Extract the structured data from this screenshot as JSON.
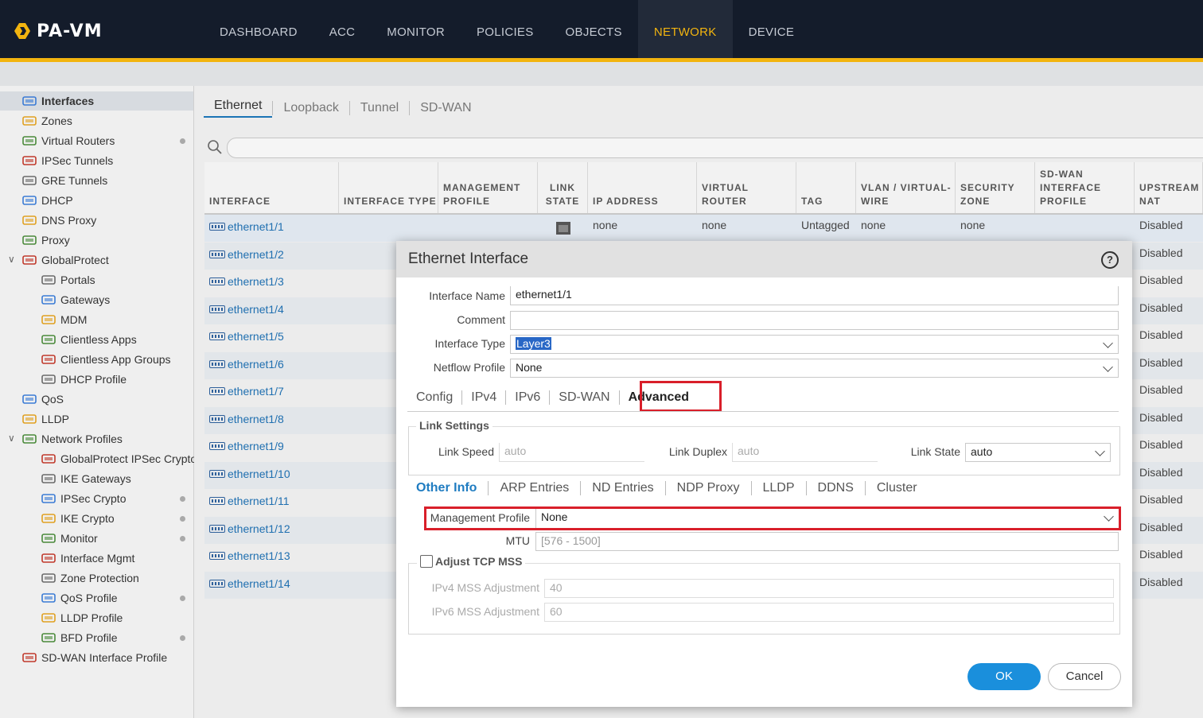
{
  "app": {
    "logo_text": "PA-VM"
  },
  "nav": {
    "items": [
      "DASHBOARD",
      "ACC",
      "MONITOR",
      "POLICIES",
      "OBJECTS",
      "NETWORK",
      "DEVICE"
    ],
    "active": "NETWORK"
  },
  "sidebar": {
    "items": [
      {
        "label": "Interfaces",
        "icon": "interfaces-icon",
        "selected": true
      },
      {
        "label": "Zones",
        "icon": "zones-icon"
      },
      {
        "label": "Virtual Routers",
        "icon": "router-icon",
        "dot": true
      },
      {
        "label": "IPSec Tunnels",
        "icon": "lock-icon"
      },
      {
        "label": "GRE Tunnels",
        "icon": "tunnel-icon"
      },
      {
        "label": "DHCP",
        "icon": "dhcp-icon"
      },
      {
        "label": "DNS Proxy",
        "icon": "dns-icon"
      },
      {
        "label": "Proxy",
        "icon": "proxy-icon"
      },
      {
        "label": "GlobalProtect",
        "icon": "globe-icon",
        "expanded": true
      },
      {
        "label": "Portals",
        "icon": "portal-icon",
        "indent": true
      },
      {
        "label": "Gateways",
        "icon": "gateway-icon",
        "indent": true
      },
      {
        "label": "MDM",
        "icon": "mdm-icon",
        "indent": true
      },
      {
        "label": "Clientless Apps",
        "icon": "apps-icon",
        "indent": true
      },
      {
        "label": "Clientless App Groups",
        "icon": "app-groups-icon",
        "indent": true
      },
      {
        "label": "DHCP Profile",
        "icon": "dhcp-profile-icon",
        "indent": true
      },
      {
        "label": "QoS",
        "icon": "qos-icon"
      },
      {
        "label": "LLDP",
        "icon": "lldp-icon"
      },
      {
        "label": "Network Profiles",
        "icon": "folder-icon",
        "expanded": true
      },
      {
        "label": "GlobalProtect IPSec Crypto",
        "icon": "lock-icon",
        "indent": true
      },
      {
        "label": "IKE Gateways",
        "icon": "ike-icon",
        "indent": true
      },
      {
        "label": "IPSec Crypto",
        "icon": "lock-icon",
        "indent": true,
        "dot": true
      },
      {
        "label": "IKE Crypto",
        "icon": "lock-icon",
        "indent": true,
        "dot": true
      },
      {
        "label": "Monitor",
        "icon": "monitor-icon",
        "indent": true,
        "dot": true
      },
      {
        "label": "Interface Mgmt",
        "icon": "mgmt-icon",
        "indent": true
      },
      {
        "label": "Zone Protection",
        "icon": "shield-icon",
        "indent": true
      },
      {
        "label": "QoS Profile",
        "icon": "qos-icon",
        "indent": true,
        "dot": true
      },
      {
        "label": "LLDP Profile",
        "icon": "lldp-icon",
        "indent": true
      },
      {
        "label": "BFD Profile",
        "icon": "bfd-icon",
        "indent": true,
        "dot": true
      },
      {
        "label": "SD-WAN Interface Profile",
        "icon": "sdwan-icon"
      }
    ]
  },
  "tabs": {
    "items": [
      "Ethernet",
      "Loopback",
      "Tunnel",
      "SD-WAN"
    ],
    "active": "Ethernet"
  },
  "table": {
    "headers": [
      [
        "INTERFACE"
      ],
      [
        "INTERFACE TYPE"
      ],
      [
        "MANAGEMENT",
        "PROFILE"
      ],
      [
        "LINK",
        "STATE"
      ],
      [
        "IP ADDRESS"
      ],
      [
        "VIRTUAL",
        "ROUTER"
      ],
      [
        "TAG"
      ],
      [
        "VLAN / VIRTUAL-",
        "WIRE"
      ],
      [
        "SECURITY",
        "ZONE"
      ],
      [
        "SD-WAN",
        "INTERFACE",
        "PROFILE"
      ],
      [
        "UPSTREAM",
        "NAT"
      ]
    ],
    "first_row": {
      "ip": "none",
      "router": "none",
      "tag": "Untagged",
      "vlan": "none",
      "zone": "none"
    },
    "rows": [
      {
        "name": "ethernet1/1",
        "nat": "Disabled"
      },
      {
        "name": "ethernet1/2",
        "nat": "Disabled"
      },
      {
        "name": "ethernet1/3",
        "nat": "Disabled"
      },
      {
        "name": "ethernet1/4",
        "nat": "Disabled"
      },
      {
        "name": "ethernet1/5",
        "nat": "Disabled"
      },
      {
        "name": "ethernet1/6",
        "nat": "Disabled"
      },
      {
        "name": "ethernet1/7",
        "nat": "Disabled"
      },
      {
        "name": "ethernet1/8",
        "nat": "Disabled"
      },
      {
        "name": "ethernet1/9",
        "nat": "Disabled"
      },
      {
        "name": "ethernet1/10",
        "nat": "Disabled"
      },
      {
        "name": "ethernet1/11",
        "nat": "Disabled"
      },
      {
        "name": "ethernet1/12",
        "nat": "Disabled"
      },
      {
        "name": "ethernet1/13",
        "nat": "Disabled"
      },
      {
        "name": "ethernet1/14",
        "nat": "Disabled"
      }
    ]
  },
  "modal": {
    "title": "Ethernet Interface",
    "help_label": "?",
    "fields": {
      "interface_name": {
        "label": "Interface Name",
        "value": "ethernet1/1"
      },
      "comment": {
        "label": "Comment",
        "value": ""
      },
      "interface_type": {
        "label": "Interface Type",
        "value": "Layer3"
      },
      "netflow_profile": {
        "label": "Netflow Profile",
        "value": "None"
      }
    },
    "tabs": [
      "Config",
      "IPv4",
      "IPv6",
      "SD-WAN",
      "Advanced"
    ],
    "active_tab": "Advanced",
    "link_settings": {
      "legend": "Link Settings",
      "speed_label": "Link Speed",
      "speed_value": "auto",
      "duplex_label": "Link Duplex",
      "duplex_value": "auto",
      "state_label": "Link State",
      "state_value": "auto"
    },
    "subtabs": [
      "Other Info",
      "ARP Entries",
      "ND Entries",
      "NDP Proxy",
      "LLDP",
      "DDNS",
      "Cluster"
    ],
    "active_subtab": "Other Info",
    "mgmt_profile": {
      "label": "Management Profile",
      "value": "None"
    },
    "mtu": {
      "label": "MTU",
      "placeholder": "[576 - 1500]"
    },
    "tcp_mss": {
      "legend": "Adjust TCP MSS",
      "ipv4_label": "IPv4 MSS Adjustment",
      "ipv4_value": "40",
      "ipv6_label": "IPv6 MSS Adjustment",
      "ipv6_value": "60"
    },
    "ok_label": "OK",
    "cancel_label": "Cancel"
  },
  "colors": {
    "accent": "#f2b40f",
    "topbar": "#141c2b",
    "link": "#1f6fb0",
    "primary_button": "#1a8fdc",
    "highlight_box": "#d91f2a"
  }
}
